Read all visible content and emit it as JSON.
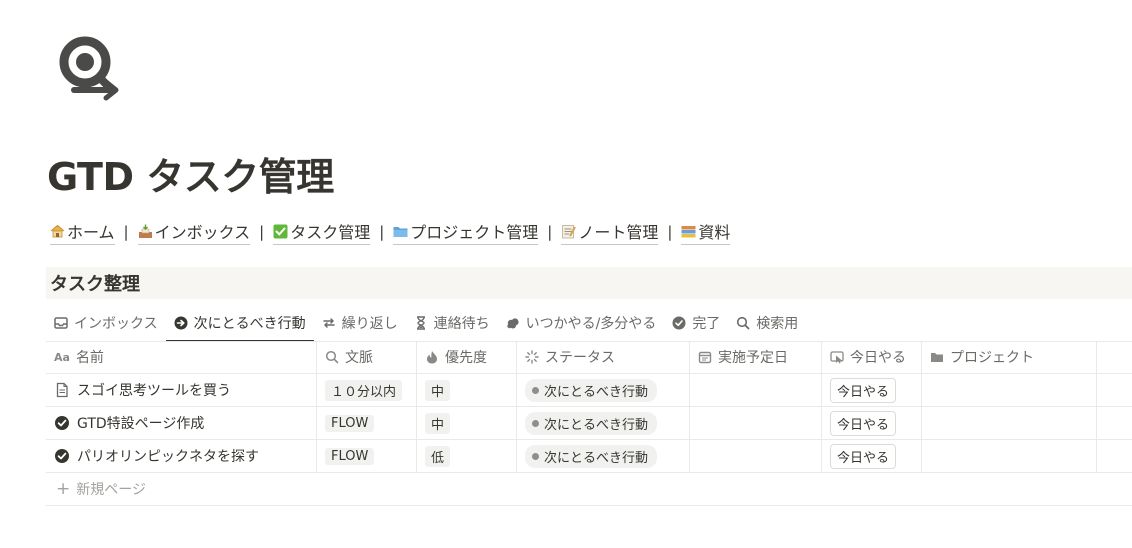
{
  "page": {
    "icon": "search-refresh-icon",
    "title": "GTD タスク管理"
  },
  "breadcrumbs": [
    {
      "label": "ホーム",
      "icon": "house-icon",
      "color": "#e9b24a"
    },
    {
      "label": "インボックス",
      "icon": "inbox-tray-icon",
      "color": "#c07a4c"
    },
    {
      "label": "タスク管理",
      "icon": "check-box-icon",
      "color": "#5fb83a"
    },
    {
      "label": "プロジェクト管理",
      "icon": "folder-icon",
      "color": "#5ba3dc"
    },
    {
      "label": "ノート管理",
      "icon": "memo-icon",
      "color": "#c9b98f"
    },
    {
      "label": "資料",
      "icon": "books-icon",
      "color": "#d88a4a"
    }
  ],
  "breadcrumb_separator": "|",
  "section": {
    "title": "タスク整理"
  },
  "views": [
    {
      "label": "インボックス",
      "icon": "inbox-icon",
      "active": false
    },
    {
      "label": "次にとるべき行動",
      "icon": "arrow-circle-icon",
      "active": true
    },
    {
      "label": "繰り返し",
      "icon": "repeat-icon",
      "active": false
    },
    {
      "label": "連絡待ち",
      "icon": "hourglass-icon",
      "active": false
    },
    {
      "label": "いつかやる/多分やる",
      "icon": "cloud-icon",
      "active": false
    },
    {
      "label": "完了",
      "icon": "check-circle-icon",
      "active": false
    },
    {
      "label": "検索用",
      "icon": "search-icon",
      "active": false
    }
  ],
  "table": {
    "columns": [
      {
        "label": "名前",
        "icon": "text-aa-icon"
      },
      {
        "label": "文脈",
        "icon": "search-icon"
      },
      {
        "label": "優先度",
        "icon": "fire-icon"
      },
      {
        "label": "ステータス",
        "icon": "loading-icon"
      },
      {
        "label": "実施予定日",
        "icon": "calendar-icon"
      },
      {
        "label": "今日やる",
        "icon": "cursor-button-icon"
      },
      {
        "label": "プロジェクト",
        "icon": "folder-icon"
      }
    ],
    "rows": [
      {
        "icon": "document-icon",
        "name": "スゴイ思考ツールを買う",
        "context": "１０分以内",
        "priority": "中",
        "status": "次にとるべき行動",
        "date": "",
        "today": "今日やる",
        "project": ""
      },
      {
        "icon": "check-circle-icon",
        "name": "GTD特設ページ作成",
        "context": "FLOW",
        "priority": "中",
        "status": "次にとるべき行動",
        "date": "",
        "today": "今日やる",
        "project": ""
      },
      {
        "icon": "check-circle-icon",
        "name": "パリオリンピックネタを探す",
        "context": "FLOW",
        "priority": "低",
        "status": "次にとるべき行動",
        "date": "",
        "today": "今日やる",
        "project": ""
      }
    ],
    "new_row_label": "新規ページ",
    "aa_label": "Aa"
  }
}
